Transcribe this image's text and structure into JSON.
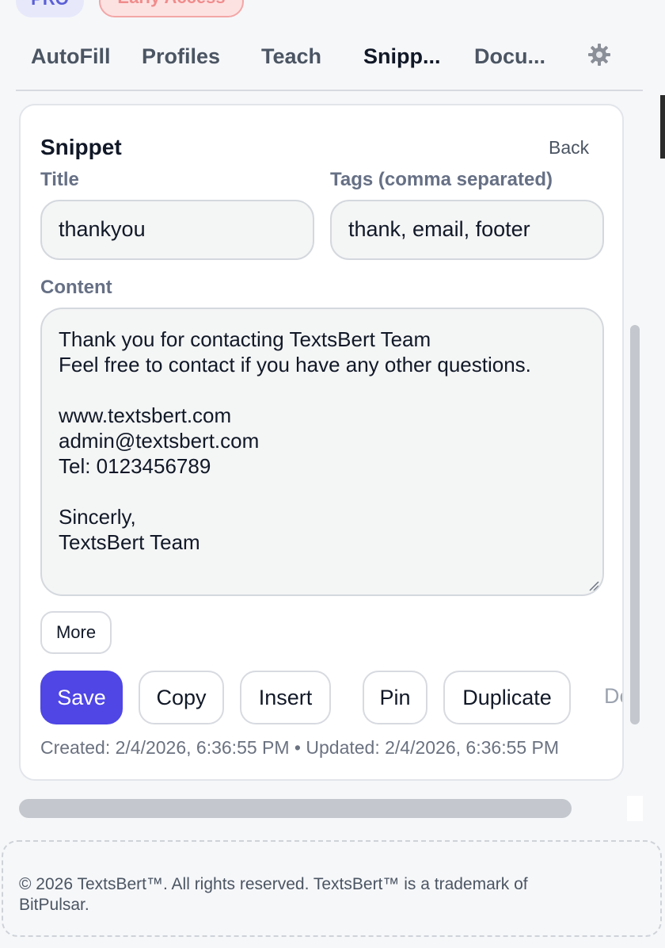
{
  "badges": {
    "pro": "PRO",
    "early": "Early Access"
  },
  "tabs": [
    {
      "label": "AutoFill"
    },
    {
      "label": "Profiles"
    },
    {
      "label": "Teach"
    },
    {
      "label": "Snipp..."
    },
    {
      "label": "Docu..."
    }
  ],
  "active_tab": "Snipp...",
  "settings_icon": "gear-icon",
  "snippet": {
    "heading": "Snippet",
    "back_label": "Back",
    "title_label": "Title",
    "title_value": "thankyou",
    "tags_label": "Tags (comma separated)",
    "tags_value": "thank, email, footer",
    "content_label": "Content",
    "content_lines": [
      "Thank you for contacting TextsBert Team",
      "Feel free to contact if you have any other questions.",
      "",
      "www.textsbert.com",
      "admin@textsbert.com",
      "Tel: 0123456789",
      "",
      "Sincerly,",
      "TextsBert Team"
    ],
    "more_label": "More",
    "actions": {
      "save": "Save",
      "copy": "Copy",
      "insert": "Insert",
      "pin": "Pin",
      "duplicate": "Duplicate",
      "partial": "De"
    },
    "meta": "Created: 2/4/2026, 6:36:55 PM • Updated: 2/4/2026, 6:36:55 PM"
  },
  "footer": {
    "line1": "© 2026 TextsBert™. All rights reserved. TextsBert™ is a trademark of",
    "line2": "BitPulsar."
  },
  "colors": {
    "accent": "#4f46e5",
    "badge_pro_bg": "#e7e9fb",
    "badge_early_bg": "#fde2e2",
    "text_primary": "#111827",
    "text_muted": "#6b7280"
  }
}
